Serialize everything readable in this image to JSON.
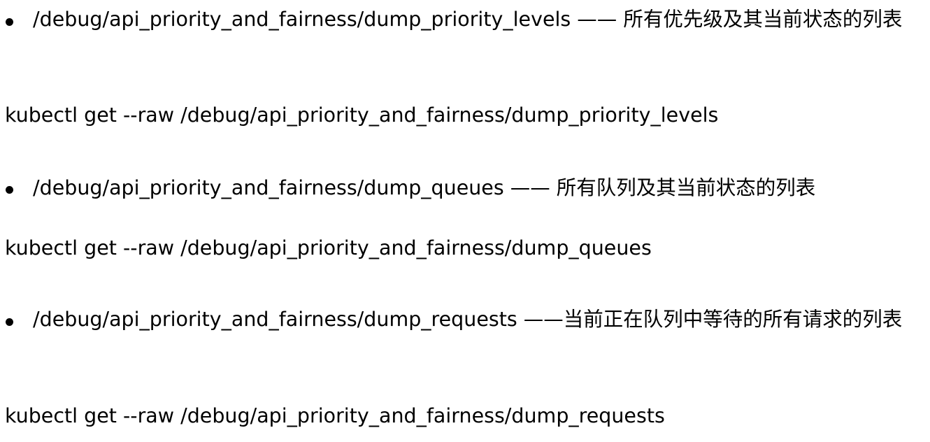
{
  "items": [
    {
      "text": "/debug/api_priority_and_fairness/dump_priority_levels —— 所有优先级及其当前状态的列表",
      "command": "kubectl get --raw /debug/api_priority_and_fairness/dump_priority_levels"
    },
    {
      "text": "/debug/api_priority_and_fairness/dump_queues —— 所有队列及其当前状态的列表",
      "command": "kubectl get --raw /debug/api_priority_and_fairness/dump_queues"
    },
    {
      "text": "/debug/api_priority_and_fairness/dump_requests ——当前正在队列中等待的所有请求的列表",
      "command": "kubectl get --raw /debug/api_priority_and_fairness/dump_requests"
    }
  ]
}
